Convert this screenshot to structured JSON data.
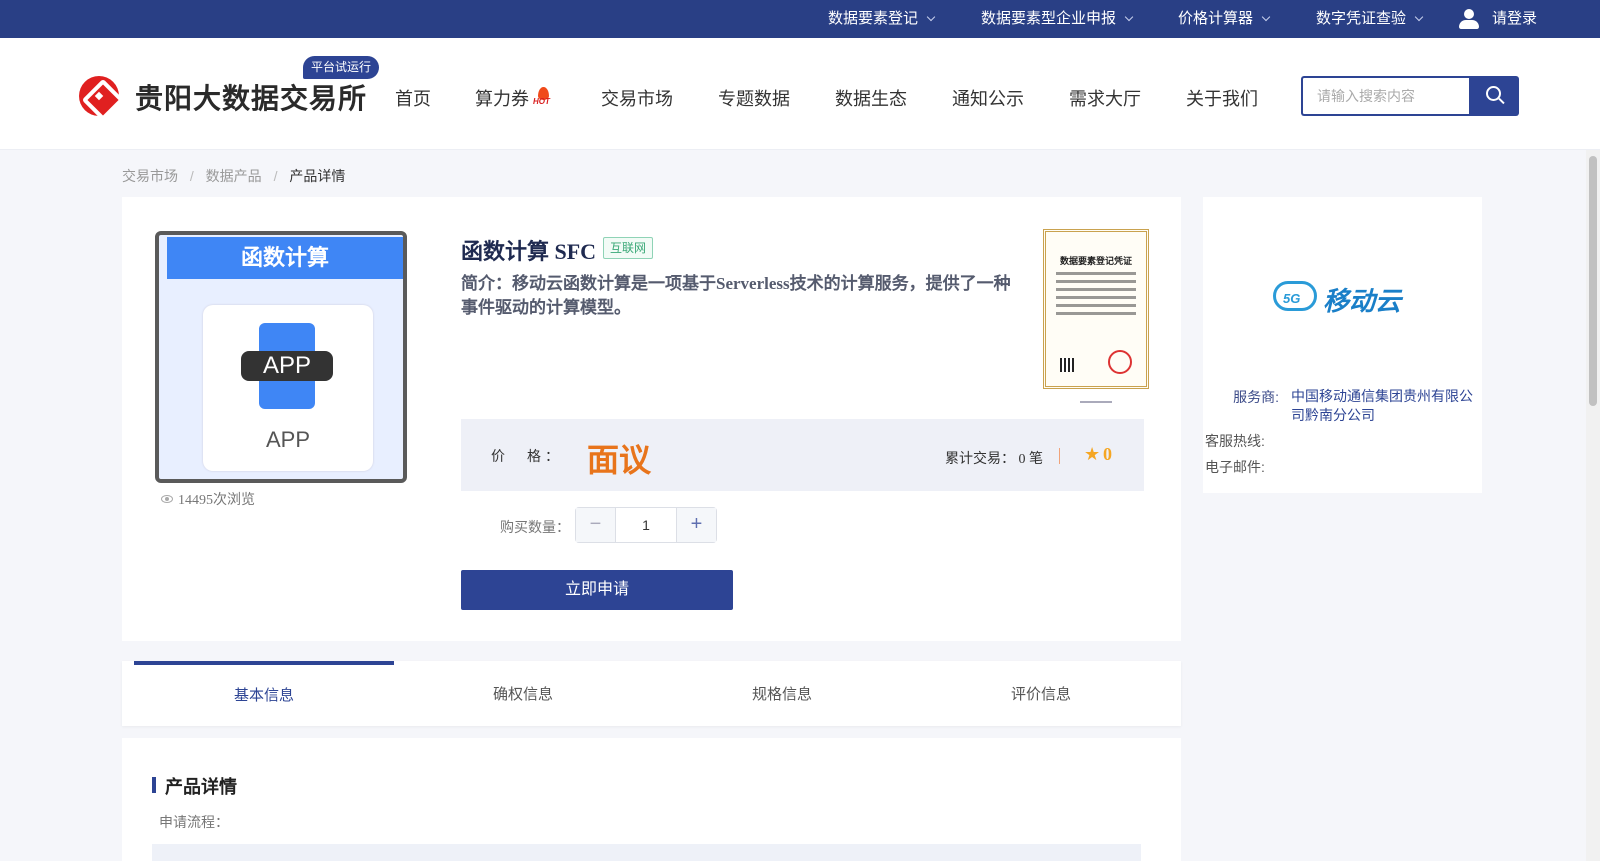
{
  "topbar": {
    "items": [
      {
        "label": "数据要素登记"
      },
      {
        "label": "数据要素型企业申报"
      },
      {
        "label": "价格计算器"
      },
      {
        "label": "数字凭证查验"
      }
    ],
    "login": "请登录"
  },
  "header": {
    "logo_text": "贵阳大数据交易所",
    "trial_badge": "平台试运行",
    "nav": [
      "首页",
      "算力券",
      "交易市场",
      "专题数据",
      "数据生态",
      "通知公示",
      "需求大厅",
      "关于我们"
    ],
    "hot_text": "HOT",
    "search_placeholder": "请输入搜索内容"
  },
  "breadcrumb": [
    "交易市场",
    "数据产品",
    "产品详情"
  ],
  "product": {
    "image_banner": "函数计算",
    "image_pill": "APP",
    "image_label": "APP",
    "views": "14495次浏览",
    "title": "函数计算 SFC",
    "tag": "互联网",
    "intro": "简介：移动云函数计算是一项基于Serverless技术的计算服务，提供了一种事件驱动的计算模型。",
    "cert_title": "数据要素登记凭证",
    "price_label": "价　格：",
    "price_value": "面议",
    "trade_text": "累计交易：  0 笔",
    "rating": "0",
    "qty_label": "购买数量：",
    "qty_value": "1",
    "apply_label": "立即申请"
  },
  "provider": {
    "brand": "移动云",
    "brand_5g": "5G",
    "service_label": "服务商:",
    "service_value": "中国移动通信集团贵州有限公司黔南分公司",
    "hotline_label": "客服热线:",
    "email_label": "电子邮件:"
  },
  "tabs": [
    "基本信息",
    "确权信息",
    "规格信息",
    "评价信息"
  ],
  "detail": {
    "title": "产品详情",
    "subtitle": "申请流程："
  },
  "colors": {
    "primary": "#2d4494",
    "topbar": "#293f85",
    "price": "#e8741b",
    "star": "#f5a623"
  }
}
